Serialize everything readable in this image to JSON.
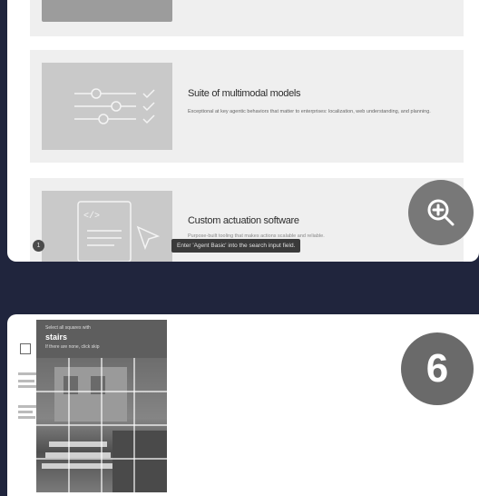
{
  "features": [
    {
      "title": "",
      "description": ""
    },
    {
      "title": "Suite of multimodal models",
      "description": "Exceptional at key agentic behaviors that matter to enterprises: localization, web understanding, and planning."
    },
    {
      "title": "Custom actuation software",
      "description": "Purpose-built tooling that makes actions scalable and reliable."
    }
  ],
  "step_number": "1",
  "tooltip": "Enter 'Agent Basic' into the search input field.",
  "zoom_icon": "zoom-in-icon",
  "captcha": {
    "prefix": "Select all squares with",
    "word": "stairs",
    "suffix": "If there are none, click skip"
  },
  "badge": "6"
}
